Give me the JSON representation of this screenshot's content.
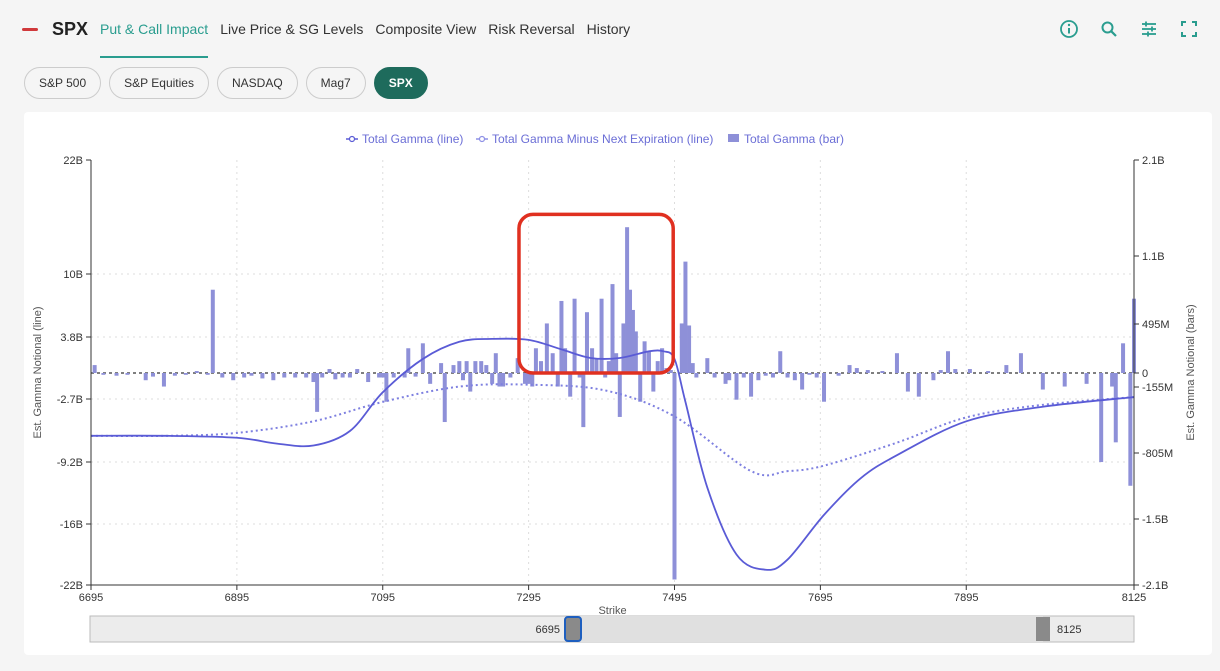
{
  "header": {
    "ticker": "SPX",
    "tabs": [
      {
        "label": "Put & Call Impact",
        "active": true
      },
      {
        "label": "Live Price & SG Levels",
        "active": false
      },
      {
        "label": "Composite View",
        "active": false
      },
      {
        "label": "Risk Reversal",
        "active": false
      },
      {
        "label": "History",
        "active": false
      }
    ],
    "icons": [
      "info-icon",
      "search-icon",
      "sliders-icon",
      "fullscreen-icon"
    ],
    "accent_color": "#2a9d8f"
  },
  "chips": [
    {
      "label": "S&P 500",
      "active": false
    },
    {
      "label": "S&P Equities",
      "active": false
    },
    {
      "label": "NASDAQ",
      "active": false
    },
    {
      "label": "Mag7",
      "active": false
    },
    {
      "label": "SPX",
      "active": true
    }
  ],
  "slider": {
    "start_label": "6695",
    "end_label": "8125"
  },
  "chart_data": {
    "type": "bar",
    "title": "",
    "xlabel": "Strike",
    "ylabel_left": "Est. Gamma Notional (line)",
    "ylabel_right": "Est. Gamma Notional (bars)",
    "xlim": [
      6695,
      8125
    ],
    "x_ticks": [
      "6695",
      "6895",
      "7095",
      "7295",
      "7495",
      "7695",
      "7895",
      "8125"
    ],
    "y_left_ticks": [
      "22B",
      "10B",
      "3.8B",
      "-2.7B",
      "-9.2B",
      "-16B",
      "-22B"
    ],
    "y_right_ticks": [
      "2.1B",
      "1.1B",
      "495M",
      "0",
      "-155M",
      "-805M",
      "-1.5B",
      "-2.1B"
    ],
    "legend": [
      {
        "name": "Total Gamma (line)",
        "style": "solid",
        "color": "#5a5bd6"
      },
      {
        "name": "Total Gamma Minus Next Expiration (line)",
        "style": "dotted",
        "color": "#8e90e6"
      },
      {
        "name": "Total Gamma (bar)",
        "style": "bar",
        "color": "#8e90d8"
      }
    ],
    "legend_position": "top-center",
    "grid": true,
    "highlight_box": {
      "x_range": [
        7290,
        7485
      ],
      "y_range_bars": [
        0,
        1450000000.0
      ],
      "color": "#e03020"
    },
    "line_total": {
      "x": [
        6695,
        6800,
        6895,
        6950,
        7000,
        7050,
        7095,
        7150,
        7200,
        7245,
        7295,
        7340,
        7380,
        7420,
        7460,
        7480,
        7495,
        7510,
        7540,
        7580,
        7620,
        7650,
        7700,
        7750,
        7800,
        7895,
        8000,
        8125
      ],
      "y": [
        -6.5,
        -6.5,
        -6.7,
        -7.3,
        -7.5,
        -6,
        -2,
        1.5,
        3.3,
        3.6,
        3.5,
        2.5,
        1.6,
        1.6,
        2.3,
        2.3,
        1.5,
        -3,
        -12,
        -19,
        -20.5,
        -19.5,
        -15,
        -11,
        -8.5,
        -5,
        -3.5,
        -2.5
      ]
    },
    "line_minus_next": {
      "x": [
        6695,
        6800,
        6895,
        7000,
        7095,
        7200,
        7295,
        7400,
        7495,
        7600,
        7650,
        7700,
        7800,
        7895,
        8000,
        8125
      ],
      "y": [
        -6.5,
        -6.5,
        -6.2,
        -5,
        -3,
        -1.4,
        -1.2,
        -1.8,
        -4.5,
        -10.2,
        -10.2,
        -9.6,
        -7.2,
        -4.6,
        -3.3,
        -2.5
      ]
    },
    "bars_units": "dollars",
    "bars": [
      [
        6700,
        80000000.0
      ],
      [
        6712,
        -20000000.0
      ],
      [
        6730,
        -30000000.0
      ],
      [
        6745,
        -20000000.0
      ],
      [
        6770,
        -80000000.0
      ],
      [
        6780,
        -40000000.0
      ],
      [
        6795,
        -150000000.0
      ],
      [
        6810,
        -30000000.0
      ],
      [
        6825,
        -20000000.0
      ],
      [
        6840,
        20000000.0
      ],
      [
        6855,
        -20000000.0
      ],
      [
        6862,
        800000000.0
      ],
      [
        6875,
        -50000000.0
      ],
      [
        6890,
        -80000000.0
      ],
      [
        6905,
        -50000000.0
      ],
      [
        6915,
        -30000000.0
      ],
      [
        6930,
        -60000000.0
      ],
      [
        6945,
        -80000000.0
      ],
      [
        6960,
        -50000000.0
      ],
      [
        6975,
        -50000000.0
      ],
      [
        6990,
        -50000000.0
      ],
      [
        7000,
        -100000000.0
      ],
      [
        7005,
        -400000000.0
      ],
      [
        7012,
        -50000000.0
      ],
      [
        7022,
        40000000.0
      ],
      [
        7030,
        -70000000.0
      ],
      [
        7040,
        -50000000.0
      ],
      [
        7050,
        -50000000.0
      ],
      [
        7060,
        40000000.0
      ],
      [
        7075,
        -100000000.0
      ],
      [
        7090,
        -50000000.0
      ],
      [
        7095,
        -50000000.0
      ],
      [
        7100,
        -300000000.0
      ],
      [
        7110,
        -50000000.0
      ],
      [
        7125,
        -50000000.0
      ],
      [
        7130,
        250000000.0
      ],
      [
        7140,
        -40000000.0
      ],
      [
        7150,
        300000000.0
      ],
      [
        7160,
        -120000000.0
      ],
      [
        7175,
        100000000.0
      ],
      [
        7180,
        -500000000.0
      ],
      [
        7192,
        80000000.0
      ],
      [
        7200,
        120000000.0
      ],
      [
        7205,
        -80000000.0
      ],
      [
        7210,
        120000000.0
      ],
      [
        7215,
        -200000000.0
      ],
      [
        7222,
        120000000.0
      ],
      [
        7230,
        120000000.0
      ],
      [
        7237,
        80000000.0
      ],
      [
        7245,
        -120000000.0
      ],
      [
        7250,
        200000000.0
      ],
      [
        7255,
        -150000000.0
      ],
      [
        7260,
        -150000000.0
      ],
      [
        7270,
        -50000000.0
      ],
      [
        7280,
        150000000.0
      ],
      [
        7290,
        -120000000.0
      ],
      [
        7295,
        -120000000.0
      ],
      [
        7300,
        -150000000.0
      ],
      [
        7305,
        250000000.0
      ],
      [
        7312,
        120000000.0
      ],
      [
        7320,
        500000000.0
      ],
      [
        7328,
        200000000.0
      ],
      [
        7335,
        -150000000.0
      ],
      [
        7340,
        700000000.0
      ],
      [
        7345,
        250000000.0
      ],
      [
        7352,
        -250000000.0
      ],
      [
        7358,
        720000000.0
      ],
      [
        7365,
        -50000000.0
      ],
      [
        7370,
        -550000000.0
      ],
      [
        7375,
        600000000.0
      ],
      [
        7382,
        250000000.0
      ],
      [
        7388,
        150000000.0
      ],
      [
        7395,
        720000000.0
      ],
      [
        7400,
        -50000000.0
      ],
      [
        7405,
        120000000.0
      ],
      [
        7410,
        850000000.0
      ],
      [
        7415,
        200000000.0
      ],
      [
        7420,
        -450000000.0
      ],
      [
        7425,
        500000000.0
      ],
      [
        7430,
        1400000000.0
      ],
      [
        7434,
        800000000.0
      ],
      [
        7438,
        620000000.0
      ],
      [
        7442,
        420000000.0
      ],
      [
        7448,
        -300000000.0
      ],
      [
        7454,
        320000000.0
      ],
      [
        7460,
        220000000.0
      ],
      [
        7466,
        -200000000.0
      ],
      [
        7472,
        120000000.0
      ],
      [
        7478,
        250000000.0
      ],
      [
        7484,
        50000000.0
      ],
      [
        7490,
        30000000.0
      ],
      [
        7495,
        -2050000000.0
      ],
      [
        7505,
        500000000.0
      ],
      [
        7510,
        1050000000.0
      ],
      [
        7515,
        480000000.0
      ],
      [
        7520,
        100000000.0
      ],
      [
        7525,
        -50000000.0
      ],
      [
        7540,
        150000000.0
      ],
      [
        7550,
        -50000000.0
      ],
      [
        7565,
        -120000000.0
      ],
      [
        7570,
        -80000000.0
      ],
      [
        7580,
        -280000000.0
      ],
      [
        7590,
        -50000000.0
      ],
      [
        7600,
        -250000000.0
      ],
      [
        7610,
        -80000000.0
      ],
      [
        7620,
        -30000000.0
      ],
      [
        7630,
        -50000000.0
      ],
      [
        7640,
        220000000.0
      ],
      [
        7650,
        -50000000.0
      ],
      [
        7660,
        -80000000.0
      ],
      [
        7670,
        -180000000.0
      ],
      [
        7680,
        -20000000.0
      ],
      [
        7690,
        -50000000.0
      ],
      [
        7700,
        -300000000.0
      ],
      [
        7720,
        -30000000.0
      ],
      [
        7735,
        80000000.0
      ],
      [
        7745,
        50000000.0
      ],
      [
        7760,
        30000000.0
      ],
      [
        7780,
        20000000.0
      ],
      [
        7800,
        200000000.0
      ],
      [
        7815,
        -200000000.0
      ],
      [
        7830,
        -250000000.0
      ],
      [
        7850,
        -80000000.0
      ],
      [
        7860,
        30000000.0
      ],
      [
        7870,
        220000000.0
      ],
      [
        7880,
        40000000.0
      ],
      [
        7900,
        40000000.0
      ],
      [
        7925,
        20000000.0
      ],
      [
        7950,
        80000000.0
      ],
      [
        7970,
        200000000.0
      ],
      [
        8000,
        -180000000.0
      ],
      [
        8030,
        -150000000.0
      ],
      [
        8060,
        -120000000.0
      ],
      [
        8080,
        -900000000.0
      ],
      [
        8095,
        -150000000.0
      ],
      [
        8100,
        -700000000.0
      ],
      [
        8110,
        300000000.0
      ],
      [
        8120,
        -1150000000.0
      ],
      [
        8125,
        720000000.0
      ]
    ]
  }
}
